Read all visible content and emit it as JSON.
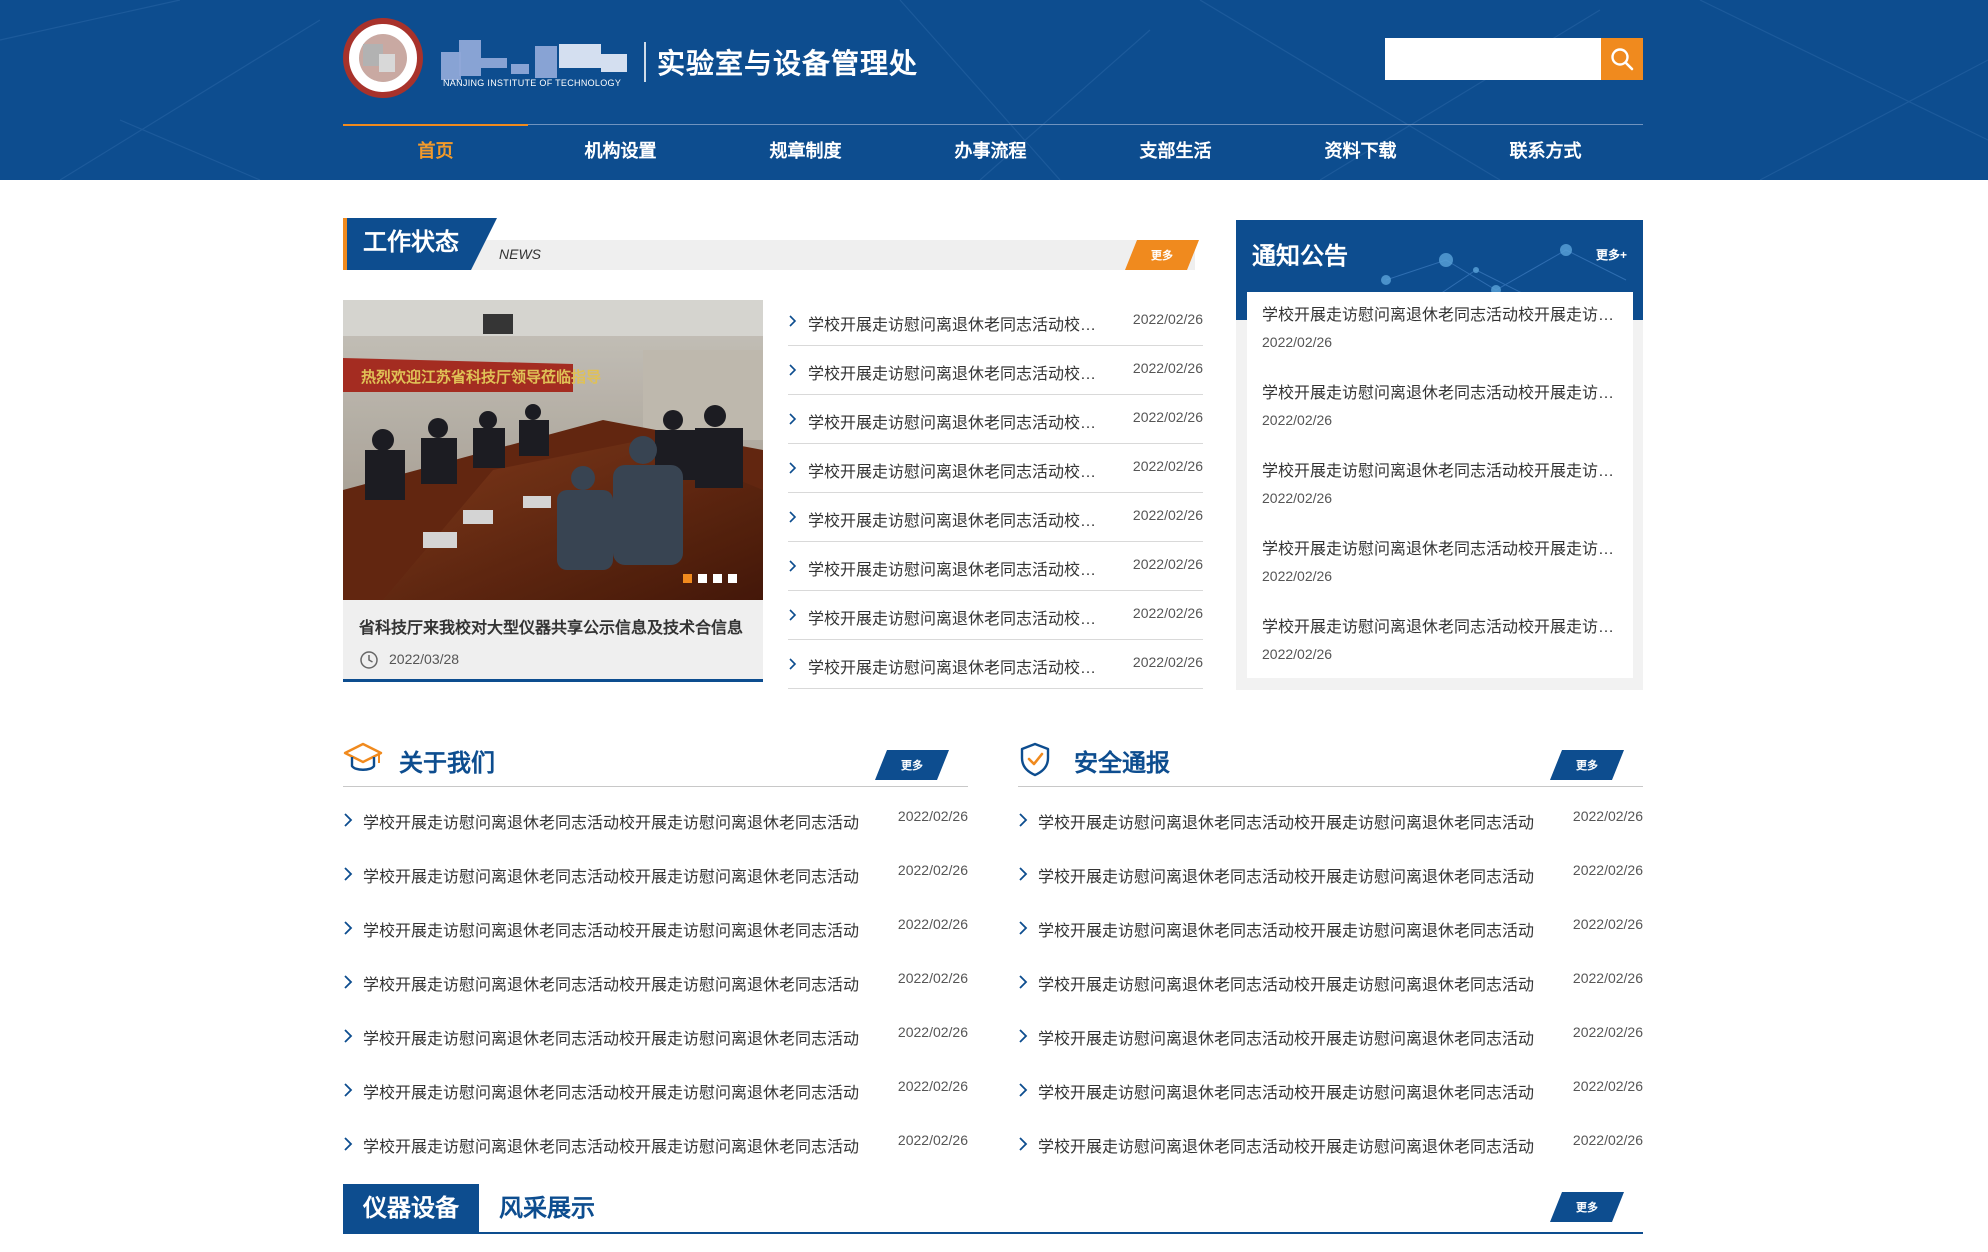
{
  "header": {
    "school_en": "NANJING INSTITUTE OF TECHNOLOGY",
    "dept_title": "实验室与设备管理处",
    "search_placeholder": "",
    "brand_color": "#0d4d8f",
    "accent_color": "#f08a1e"
  },
  "nav": [
    {
      "label": "首页",
      "active": true
    },
    {
      "label": "机构设置"
    },
    {
      "label": "规章制度"
    },
    {
      "label": "办事流程"
    },
    {
      "label": "支部生活"
    },
    {
      "label": "资料下载"
    },
    {
      "label": "联系方式"
    }
  ],
  "work": {
    "title": "工作状态",
    "tag": "NEWS",
    "more": "更多",
    "slide_caption": "省科技厅来我校对大型仪器共享公示信息及技术合信息",
    "slide_date": "2022/03/28",
    "slide_banner": "热烈欢迎江苏省科技厅领导莅临指导",
    "items": [
      {
        "title": "学校开展走访慰问离退休老同志活动校开展走访慰问离退休老同志活动",
        "date": "2022/02/26"
      },
      {
        "title": "学校开展走访慰问离退休老同志活动校开展走访慰问离退休老同志活动",
        "date": "2022/02/26"
      },
      {
        "title": "学校开展走访慰问离退休老同志活动校开展走访慰问离退休老同志活动",
        "date": "2022/02/26"
      },
      {
        "title": "学校开展走访慰问离退休老同志活动校开展走访慰问离退休老同志活动",
        "date": "2022/02/26"
      },
      {
        "title": "学校开展走访慰问离退休老同志活动校开展走访慰问离退休老同志活动",
        "date": "2022/02/26"
      },
      {
        "title": "学校开展走访慰问离退休老同志活动校开展走访慰问离退休老同志活动",
        "date": "2022/02/26"
      },
      {
        "title": "学校开展走访慰问离退休老同志活动校开展走访慰问离退休老同志活动",
        "date": "2022/02/26"
      },
      {
        "title": "学校开展走访慰问离退休老同志活动校开展走访慰问离退休老同志活动",
        "date": "2022/02/26"
      }
    ]
  },
  "notice": {
    "title": "通知公告",
    "more": "更多+",
    "items": [
      {
        "title": "学校开展走访慰问离退休老同志活动校开展走访慰问离退休老同志活动",
        "date": "2022/02/26"
      },
      {
        "title": "学校开展走访慰问离退休老同志活动校开展走访慰问离退休老同志活动",
        "date": "2022/02/26"
      },
      {
        "title": "学校开展走访慰问离退休老同志活动校开展走访慰问离退休老同志活动",
        "date": "2022/02/26"
      },
      {
        "title": "学校开展走访慰问离退休老同志活动校开展走访慰问离退休老同志活动",
        "date": "2022/02/26"
      },
      {
        "title": "学校开展走访慰问离退休老同志活动校开展走访慰问离退休老同志活动",
        "date": "2022/02/26"
      }
    ]
  },
  "about": {
    "title": "关于我们",
    "more": "更多",
    "items": [
      {
        "title": "学校开展走访慰问离退休老同志活动校开展走访慰问离退休老同志活动",
        "date": "2022/02/26"
      },
      {
        "title": "学校开展走访慰问离退休老同志活动校开展走访慰问离退休老同志活动",
        "date": "2022/02/26"
      },
      {
        "title": "学校开展走访慰问离退休老同志活动校开展走访慰问离退休老同志活动",
        "date": "2022/02/26"
      },
      {
        "title": "学校开展走访慰问离退休老同志活动校开展走访慰问离退休老同志活动",
        "date": "2022/02/26"
      },
      {
        "title": "学校开展走访慰问离退休老同志活动校开展走访慰问离退休老同志活动",
        "date": "2022/02/26"
      },
      {
        "title": "学校开展走访慰问离退休老同志活动校开展走访慰问离退休老同志活动",
        "date": "2022/02/26"
      },
      {
        "title": "学校开展走访慰问离退休老同志活动校开展走访慰问离退休老同志活动",
        "date": "2022/02/26"
      }
    ]
  },
  "safety": {
    "title": "安全通报",
    "more": "更多",
    "items": [
      {
        "title": "学校开展走访慰问离退休老同志活动校开展走访慰问离退休老同志活动",
        "date": "2022/02/26"
      },
      {
        "title": "学校开展走访慰问离退休老同志活动校开展走访慰问离退休老同志活动",
        "date": "2022/02/26"
      },
      {
        "title": "学校开展走访慰问离退休老同志活动校开展走访慰问离退休老同志活动",
        "date": "2022/02/26"
      },
      {
        "title": "学校开展走访慰问离退休老同志活动校开展走访慰问离退休老同志活动",
        "date": "2022/02/26"
      },
      {
        "title": "学校开展走访慰问离退休老同志活动校开展走访慰问离退休老同志活动",
        "date": "2022/02/26"
      },
      {
        "title": "学校开展走访慰问离退休老同志活动校开展走访慰问离退休老同志活动",
        "date": "2022/02/26"
      },
      {
        "title": "学校开展走访慰问离退休老同志活动校开展走访慰问离退休老同志活动",
        "date": "2022/02/26"
      }
    ]
  },
  "bottom": {
    "tab_active": "仪器设备",
    "tab_other": "风采展示",
    "more": "更多"
  }
}
